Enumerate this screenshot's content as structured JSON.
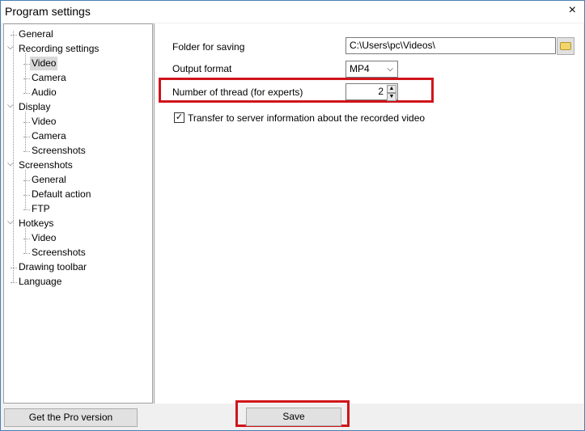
{
  "window": {
    "title": "Program settings",
    "close_icon": "×"
  },
  "tree": [
    {
      "label": "General",
      "level": 0
    },
    {
      "label": "Recording settings",
      "level": 0,
      "expanded": true
    },
    {
      "label": "Video",
      "level": 1,
      "selected": true
    },
    {
      "label": "Camera",
      "level": 1
    },
    {
      "label": "Audio",
      "level": 1
    },
    {
      "label": "Display",
      "level": 0,
      "expanded": true
    },
    {
      "label": "Video",
      "level": 1
    },
    {
      "label": "Camera",
      "level": 1
    },
    {
      "label": "Screenshots",
      "level": 1
    },
    {
      "label": "Screenshots",
      "level": 0,
      "expanded": true
    },
    {
      "label": "General",
      "level": 1
    },
    {
      "label": "Default action",
      "level": 1
    },
    {
      "label": "FTP",
      "level": 1
    },
    {
      "label": "Hotkeys",
      "level": 0,
      "expanded": true
    },
    {
      "label": "Video",
      "level": 1
    },
    {
      "label": "Screenshots",
      "level": 1
    },
    {
      "label": "Drawing toolbar",
      "level": 0
    },
    {
      "label": "Language",
      "level": 0
    }
  ],
  "form": {
    "folder_label": "Folder for saving",
    "folder_value": "C:\\Users\\pc\\Videos\\",
    "format_label": "Output format",
    "format_value": "MP4",
    "threads_label": "Number of thread (for experts)",
    "threads_value": "2",
    "transfer_label": "Transfer to server information about the recorded video",
    "transfer_checked": true
  },
  "buttons": {
    "pro": "Get the Pro version",
    "save": "Save"
  },
  "colors": {
    "highlight": "#d0141b"
  }
}
